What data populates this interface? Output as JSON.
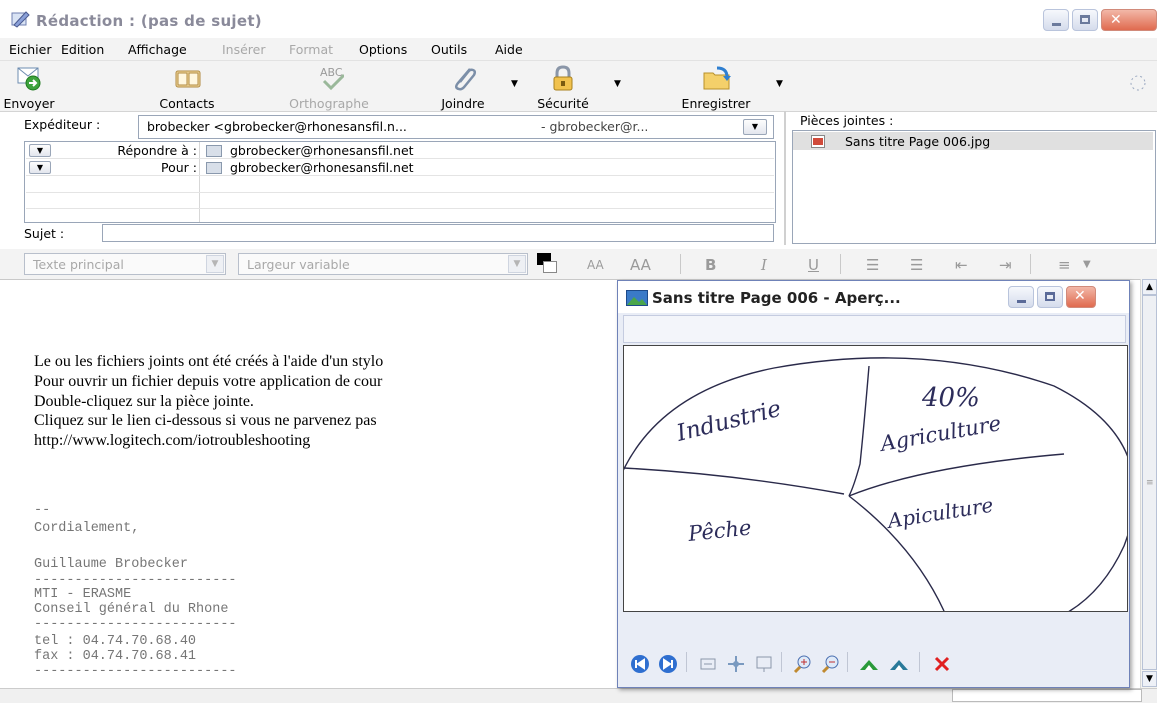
{
  "window": {
    "title": "Rédaction : (pas de sujet)"
  },
  "menu": [
    "Eichier",
    "Edition",
    "Affichage",
    "Insérer",
    "Format",
    "Options",
    "Outils",
    "Aide"
  ],
  "menu_disabled": [
    "Insérer",
    "Format"
  ],
  "toolbar": {
    "send": "Envoyer",
    "contacts": "Contacts",
    "spelling": "Orthographe",
    "attach": "Joindre",
    "security": "Sécurité",
    "save": "Enregistrer"
  },
  "header": {
    "from_label": "Expéditeur :",
    "from_value": "brobecker <gbrobecker@rhonesansfil.n...",
    "from_suffix": "- gbrobecker@r...",
    "recipients": [
      {
        "type": "Répondre à :",
        "address": "gbrobecker@rhonesansfil.net"
      },
      {
        "type": "Pour :",
        "address": "gbrobecker@rhonesansfil.net"
      }
    ],
    "subject_label": "Sujet :",
    "subject_value": ""
  },
  "attachments": {
    "label": "Pièces jointes :",
    "items": [
      "Sans titre Page 006.jpg"
    ]
  },
  "format_bar": {
    "paragraph_style": "Texte principal",
    "font": "Largeur variable",
    "bold": "B",
    "italic": "I",
    "underline": "U",
    "smaller": "AA",
    "larger": "AA"
  },
  "body": {
    "lines": [
      "Le ou les fichiers joints ont été créés à l'aide d'un stylo",
      "Pour ouvrir un fichier depuis votre application de cour",
      "Double-cliquez sur la pièce jointe.",
      "Cliquez sur le lien ci-dessous si vous ne parvenez pas",
      "http://www.logitech.com/iotroubleshooting"
    ],
    "signature": [
      "--",
      "Cordialement,",
      "",
      "Guillaume Brobecker",
      "-------------------------",
      "    MTI - ERASME",
      "Conseil général du Rhone",
      "-------------------------",
      "tel : 04.74.70.68.40",
      "fax : 04.74.70.68.41",
      "-------------------------"
    ]
  },
  "preview": {
    "title": "Sans titre Page 006 - Aperç...",
    "sketch": {
      "labels": [
        "Industrie",
        "40%",
        "Agriculture",
        "Pêche",
        "Apiculture"
      ]
    }
  },
  "colors": {
    "accent": "#6f82b8",
    "close": "#e06a4f",
    "title_text": "#8a8a9a"
  }
}
